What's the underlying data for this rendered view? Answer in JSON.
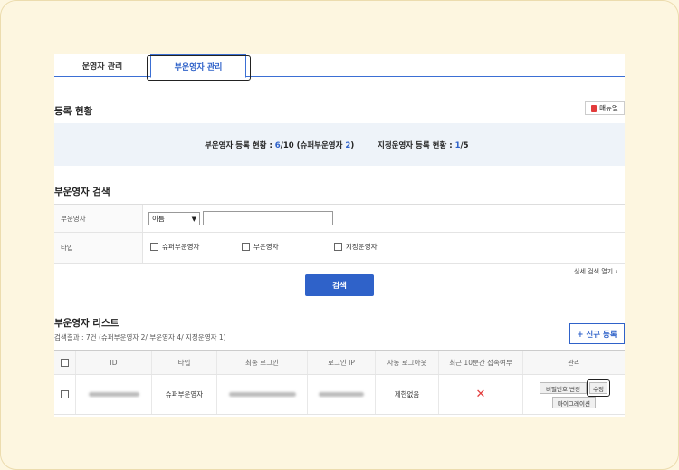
{
  "tabs": [
    {
      "label": "운영자 관리"
    },
    {
      "label": "부운영자 관리"
    }
  ],
  "registration": {
    "title": "등록 현황",
    "manual_label": "매뉴얼",
    "sub_status_prefix": "부운영자 등록 현황 : ",
    "sub_count": "6",
    "sub_total": "/10 (슈퍼부운영자 ",
    "super_count": "2",
    "sub_suffix": ")",
    "designated_prefix": "지정운영자 등록 현황 : ",
    "designated_count": "1",
    "designated_total": "/5"
  },
  "search": {
    "title": "부운영자 검색",
    "row1_label": "부운영자",
    "select_value": "이름",
    "row2_label": "타입",
    "type_options": [
      "슈퍼부운영자",
      "부운영자",
      "지정운영자"
    ],
    "detail_link": "상세 검색 열기",
    "button_label": "검색"
  },
  "list": {
    "title": "부운영자 리스트",
    "result_text": "검색결과 : 7건 (슈퍼부운영자 2/ 부운영자 4/ 지정운영자 1)",
    "new_button": "+ 신규 등록",
    "columns": [
      "ID",
      "타입",
      "최종 로그인",
      "로그인 IP",
      "자동 로그아웃",
      "최근 10분간 접속여부",
      "관리"
    ],
    "rows": [
      {
        "type": "슈퍼부운영자",
        "auto_logout": "제한없음",
        "actions": [
          "비밀번호 변경",
          "수정",
          "마이그레이션"
        ]
      }
    ]
  },
  "colors": {
    "accent": "#2f62c9",
    "error": "#e23b3b"
  }
}
